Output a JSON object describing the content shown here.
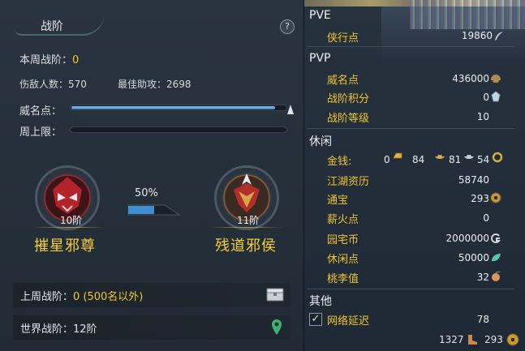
{
  "left": {
    "title": "战阶",
    "help_label": "?",
    "weekly_rank_label": "本周战阶：",
    "weekly_rank_value": "0",
    "kills_label": "伤敌人数：",
    "kills_value": "570",
    "best_assist_label": "最佳助攻：",
    "best_assist_value": "2698",
    "prestige_label": "威名点：",
    "prestige_fill": 0.95,
    "weekly_cap_label": "周上限：",
    "weekly_cap_fill": 0,
    "current_rank": {
      "level": "10阶",
      "name": "摧星邪尊"
    },
    "next_rank": {
      "level": "11阶",
      "name": "残道邪侯"
    },
    "progress_percent_text": "50%",
    "progress_fraction": 0.5,
    "last_week_label": "上周战阶：",
    "last_week_value": "0 (500名以外)",
    "world_rank_label": "世界战阶：",
    "world_rank_value": "12阶"
  },
  "right": {
    "pve": {
      "title": "PVE",
      "items": [
        {
          "name": "侠行点",
          "value": "19860",
          "icon": "feather-icon"
        }
      ]
    },
    "pvp": {
      "title": "PVP",
      "items": [
        {
          "name": "威名点",
          "value": "436000",
          "icon": "helmet-icon"
        },
        {
          "name": "战阶积分",
          "value": "0",
          "icon": "crystal-icon"
        },
        {
          "name": "战阶等级",
          "value": "10",
          "icon": ""
        }
      ]
    },
    "leisure": {
      "title": "休闲",
      "money_label": "金钱:",
      "money_gold": "0",
      "money_silver": "84",
      "money_copper": "81",
      "money_iron": "54",
      "items": [
        {
          "name": "江湖资历",
          "value": "58740",
          "icon": ""
        },
        {
          "name": "通宝",
          "value": "293",
          "icon": "coin-icon"
        },
        {
          "name": "薪火点",
          "value": "0",
          "icon": ""
        },
        {
          "name": "园宅币",
          "value": "2000000",
          "icon": "house-coin-icon"
        },
        {
          "name": "休闲点",
          "value": "50000",
          "icon": "leaf-icon"
        },
        {
          "name": "桃李值",
          "value": "32",
          "icon": "peach-icon"
        }
      ]
    },
    "other": {
      "title": "其他",
      "checkbox_mark": "✓",
      "latency_label": "网络延迟",
      "latency_value": "78"
    },
    "footer": {
      "left_value": "1327",
      "right_value": "293"
    }
  },
  "colors": {
    "accent": "#f2c92c",
    "bar": "#3a86c6",
    "panel": "#26303b"
  }
}
